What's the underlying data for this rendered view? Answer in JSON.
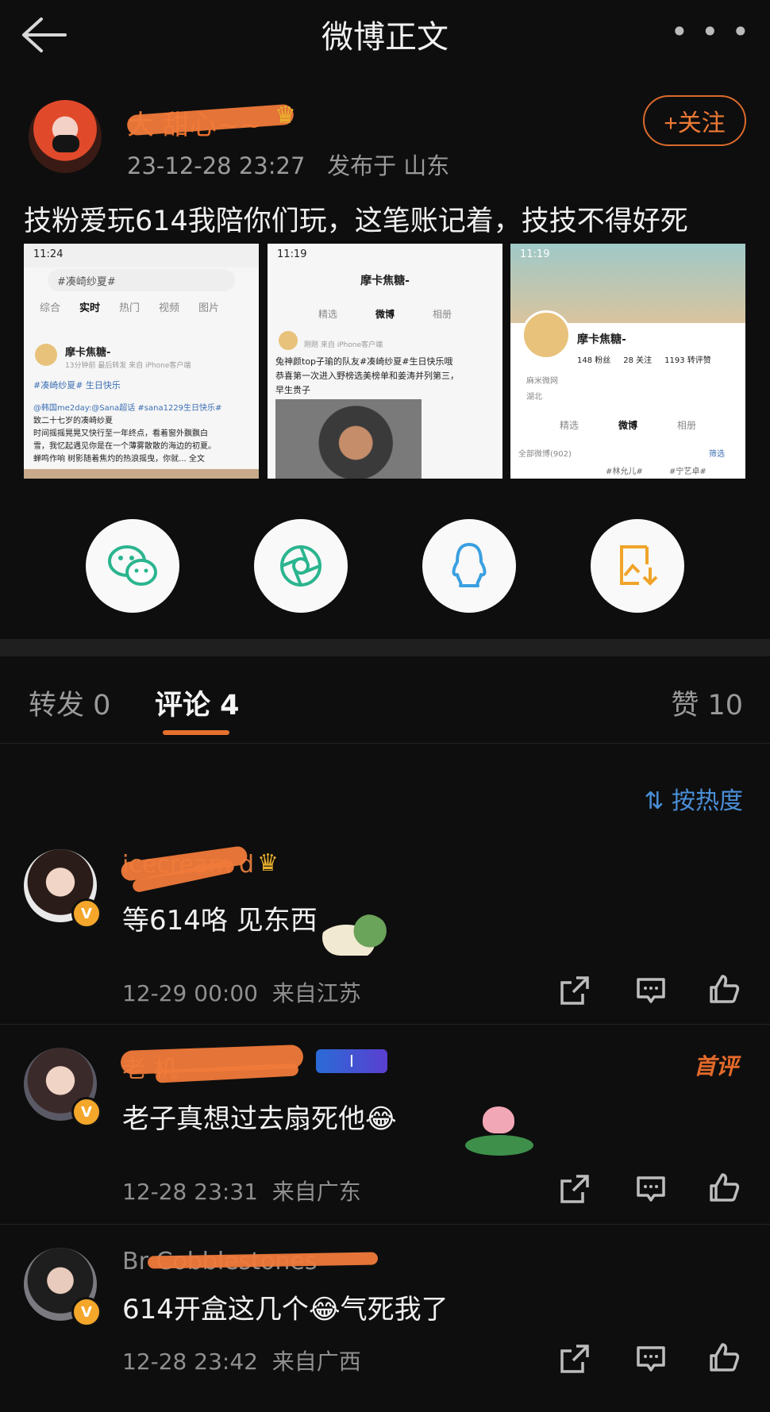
{
  "header": {
    "title": "微博正文",
    "back_icon": "back-arrow-icon",
    "more_label": "• • •"
  },
  "post": {
    "author_name": "大  甜心~~",
    "time": "23-12-28 23:27",
    "location": "发布于 山东",
    "follow_label": "+关注",
    "text": "技粉爱玩614我陪你们玩，这笔账记着，技技不得好死",
    "images": [
      {
        "status_time": "11:24",
        "search": "#凑崎纱夏#",
        "tabs": [
          "综合",
          "实时",
          "热门",
          "视频",
          "图片"
        ],
        "user": "摩卡焦糖-",
        "sub": "13分钟前  最后转发  来自 iPhone客户端",
        "lines": [
          "#凑崎纱夏# 生日快乐",
          "@韩国me2day:@Sana超话 #sana1229生日快乐#",
          "致二十七岁的凑崎纱夏",
          "时间摇摇晃晃又快行至一年终点，看着窗外飘飘白",
          "雪，我忆起遇见你是在一个薄雾散散的海边的初夏。",
          "蝉鸣作响 树影随着焦灼的热浪摇曳，你就... 全文"
        ]
      },
      {
        "status_time": "11:19",
        "nav_title": "摩卡焦糖-",
        "tabs": [
          "精选",
          "微博",
          "相册"
        ],
        "sub": "刚刚  来自 iPhone客户端",
        "lines": [
          "兔神颜top子瑜的队友#凑崎纱夏#生日快乐哦",
          "恭喜第一次进入野榜选美榜单和姜涛并列第三，",
          "早生贵子"
        ]
      },
      {
        "status_time": "11:19",
        "user": "摩卡焦糖-",
        "stats": [
          "148 粉丝",
          "28 关注",
          "1193 转评赞"
        ],
        "info": [
          "麻米微网",
          "湖北"
        ],
        "tabs": [
          "精选",
          "微博",
          "相册"
        ],
        "all_label": "全部微博(902)",
        "filter_label": "筛选",
        "tags": [
          "#林允儿#",
          "#宁艺卓#"
        ]
      }
    ]
  },
  "share": [
    {
      "name": "wechat-icon",
      "color": "#2bb58f"
    },
    {
      "name": "moments-icon",
      "color": "#2bb58f"
    },
    {
      "name": "qq-icon",
      "color": "#3aa0e0"
    },
    {
      "name": "save-image-icon",
      "color": "#f0a42a"
    }
  ],
  "tabs": {
    "repost": "转发 0",
    "comment": "评论 4",
    "like": "赞 10"
  },
  "sort_label": "按热度",
  "comments": [
    {
      "name": "icecream   d",
      "text": "等614咯 见东西",
      "time": "12-29 00:00",
      "location": "来自江苏"
    },
    {
      "name": "老  机",
      "text": "老子真想过去扇死他😂",
      "time": "12-28 23:31",
      "location": "来自广东",
      "badge": "首评"
    },
    {
      "name": "Br    Cobblestones",
      "text": "614开盒这几个😂气死我了",
      "time": "12-28 23:42",
      "location": "来自广西"
    }
  ],
  "colors": {
    "accent": "#e6702e",
    "link": "#4a8fd8",
    "background": "#0e0e0e"
  }
}
